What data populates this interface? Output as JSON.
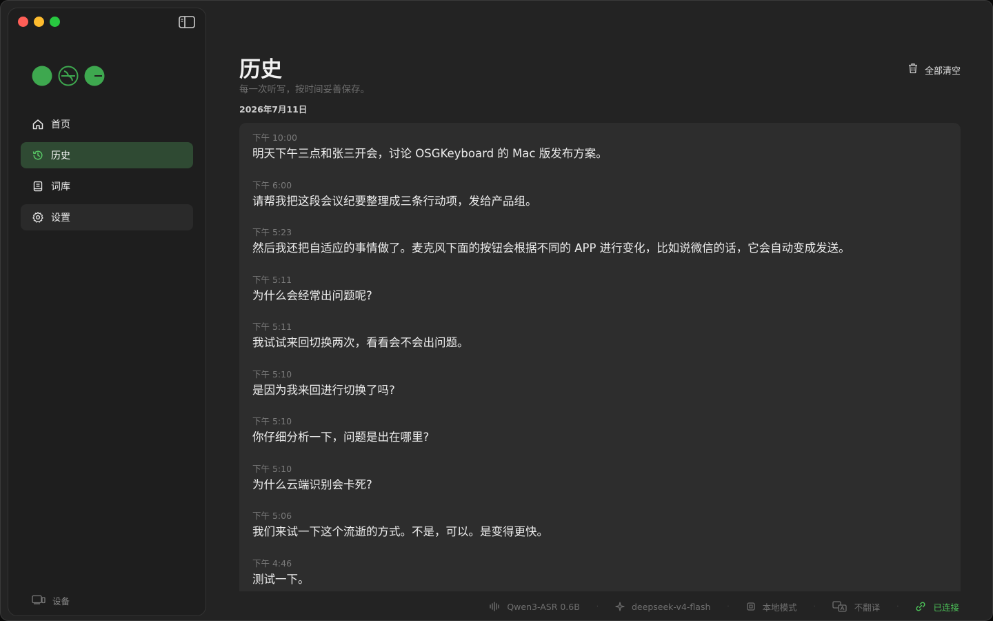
{
  "sidebar": {
    "nav": [
      {
        "label": "首页",
        "icon": "home-icon"
      },
      {
        "label": "历史",
        "icon": "history-icon"
      },
      {
        "label": "词库",
        "icon": "book-icon"
      },
      {
        "label": "设置",
        "icon": "gear-icon"
      }
    ],
    "device_label": "设备"
  },
  "main": {
    "title": "历史",
    "subtitle": "每一次听写，按时间妥善保存。",
    "clear_all_label": "全部清空",
    "date_header": "2026年7月11日",
    "entries": [
      {
        "time": "下午 10:00",
        "text": "明天下午三点和张三开会，讨论 OSGKeyboard 的 Mac 版发布方案。"
      },
      {
        "time": "下午 6:00",
        "text": "请帮我把这段会议纪要整理成三条行动项，发给产品组。"
      },
      {
        "time": "下午 5:23",
        "text": "然后我还把自适应的事情做了。麦克风下面的按钮会根据不同的 APP 进行变化，比如说微信的话，它会自动变成发送。"
      },
      {
        "time": "下午 5:11",
        "text": "为什么会经常出问题呢?"
      },
      {
        "time": "下午 5:11",
        "text": "我试试来回切换两次，看看会不会出问题。"
      },
      {
        "time": "下午 5:10",
        "text": "是因为我来回进行切换了吗?"
      },
      {
        "time": "下午 5:10",
        "text": "你仔细分析一下，问题是出在哪里?"
      },
      {
        "time": "下午 5:10",
        "text": "为什么云端识别会卡死?"
      },
      {
        "time": "下午 5:06",
        "text": "我们来试一下这个流逝的方式。不是，可以。是变得更快。"
      },
      {
        "time": "下午 4:46",
        "text": "测试一下。"
      }
    ]
  },
  "status": {
    "asr_model": "Qwen3-ASR 0.6B",
    "llm_model": "deepseek-v4-flash",
    "mode": "本地模式",
    "translate": "不翻译",
    "connection": "已连接"
  },
  "colors": {
    "accent_green": "#4cc258",
    "active_nav_bg": "#2f4a33",
    "window_bg": "#232323",
    "card_bg": "#2d2d2d"
  }
}
